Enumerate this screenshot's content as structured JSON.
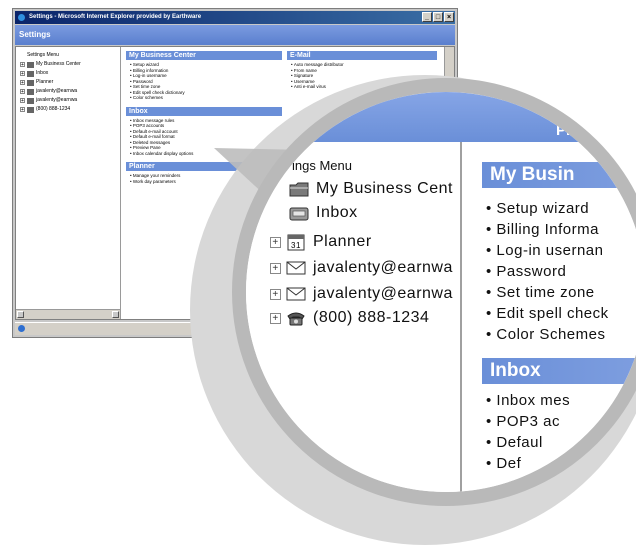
{
  "window": {
    "title": "Settings - Microsoft Internet Explorer provided by Earthware",
    "buttons": [
      "_",
      "□",
      "×"
    ],
    "settings_heading": "Settings"
  },
  "tree": {
    "menu_label": "Settings Menu",
    "items": [
      {
        "label": "My Business Center",
        "icon": "folder-icon",
        "expandable": true
      },
      {
        "label": "Inbox",
        "icon": "inbox-icon",
        "expandable": true
      },
      {
        "label": "Planner",
        "icon": "calendar-icon",
        "expandable": true
      },
      {
        "label": "javalenty@earnwa",
        "icon": "mail-icon",
        "expandable": true
      },
      {
        "label": "javalenty@earnwa",
        "icon": "mail-icon",
        "expandable": true
      },
      {
        "label": "(800) 888-1234",
        "icon": "phone-icon",
        "expandable": true
      }
    ]
  },
  "mini": {
    "business": {
      "heading": "My Business Center",
      "items": [
        "Setup wizard",
        "Billing information",
        "Log-in username",
        "Password",
        "Set time zone",
        "Edit spell check dictionary",
        "Color schemes"
      ]
    },
    "email": {
      "heading": "E-Mail",
      "items": [
        "Auto message distributor",
        "From name",
        "Signature",
        "Username",
        "Anti e-mail virus"
      ]
    },
    "inbox": {
      "heading": "Inbox",
      "items": [
        "Inbox message rules",
        "POP3 accounts",
        "Default e-mail account",
        "Default e-mail format",
        "Deleted messages",
        "Preview Pane",
        "Inbox calendar display options"
      ]
    },
    "planner": {
      "heading": "Planner",
      "items": [
        "Manage your reminders",
        "Work day parameters"
      ]
    }
  },
  "zoom": {
    "menu_label": "ings Menu",
    "rows": [
      "My Business Cent",
      "Inbox",
      "Planner",
      "javalenty@earnwa",
      "javalenty@earnwa",
      "(800) 888-1234"
    ],
    "business_heading": "My Busin",
    "business_items": [
      "Setup wizard",
      "Billing Informa",
      "Log-in usernan",
      "Password",
      "Set time zone",
      "Edit spell check",
      "Color Schemes"
    ],
    "inbox_heading": "Inbox",
    "inbox_items": [
      "Inbox mes",
      "POP3 ac",
      "Defaul",
      "Def"
    ],
    "ph_fragment": "Ph"
  },
  "colors": {
    "accent": "#6a8fd8",
    "titlebar": "#0a246a",
    "frame": "#c8c8c8"
  }
}
